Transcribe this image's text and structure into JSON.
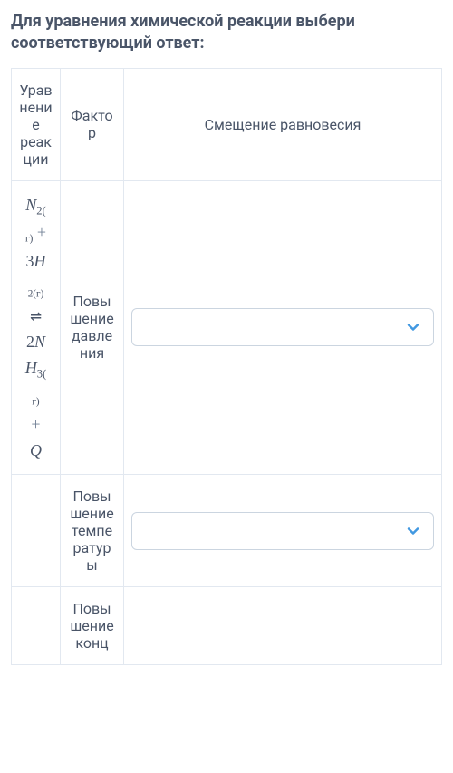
{
  "prompt": "Для уравнения химической реакции выбери соответствующий ответ:",
  "headers": {
    "equation": "Уравнение реакции",
    "factor": "Фактор",
    "shift": "Смещение равновесия"
  },
  "rows": [
    {
      "factor": "Повышение давления",
      "selected": ""
    },
    {
      "factor": "Повышение температуры",
      "selected": ""
    },
    {
      "factor": "Повышение конц",
      "selected": ""
    }
  ],
  "equation": {
    "reactant1": "N",
    "r1_sub": "2(",
    "r1_gas": "г)",
    "plus": "+",
    "coef_h": "3",
    "reactant2": "H",
    "r2_sub": "2(г)",
    "rev_arrow": "⇌",
    "coef_nh": "2",
    "product": "N",
    "product2": "H",
    "p_sub": "3(",
    "p_gas": "г)",
    "q": "Q"
  },
  "chevron_color": "#4299e1"
}
